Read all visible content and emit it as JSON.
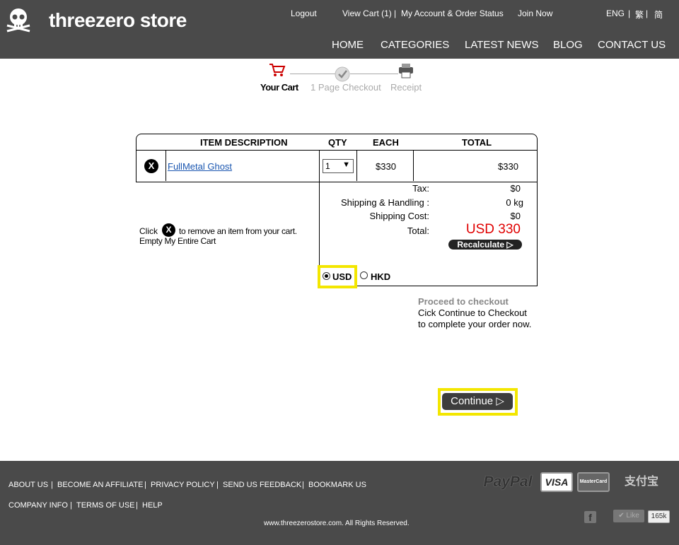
{
  "header": {
    "brand": "threezero store",
    "top_links": [
      "Logout",
      "View Cart (1)",
      "|",
      "My Account & Order Status",
      "Join Now",
      "ENG",
      "|",
      "繁",
      "|",
      "简"
    ],
    "nav": [
      "HOME",
      "CATEGORIES",
      "LATEST NEWS",
      "BLOG",
      "CONTACT US"
    ]
  },
  "progress": {
    "steps": [
      "Your Cart",
      "1 Page Checkout",
      "Receipt"
    ],
    "active_index": 0
  },
  "cart": {
    "headers": [
      "ITEM DESCRIPTION",
      "QTY",
      "EACH",
      "TOTAL"
    ],
    "remove_glyph": "X",
    "items": [
      {
        "name": "FullMetal Ghost",
        "qty": "1",
        "each": "$330",
        "total": "$330"
      }
    ],
    "help_text": {
      "before": "Click",
      "after": "to remove an item from your cart.",
      "empty": "Empty My Entire Cart"
    },
    "summary": {
      "tax_label": "Tax:",
      "tax_value": "$0",
      "shipping_label": "Shipping & Handling :",
      "shipping_value": "0 kg",
      "shipcost_label": "Shipping Cost:",
      "shipcost_value": "$0",
      "total_label": "Total:",
      "total_value": "USD 330",
      "recalc_label": "Recalculate",
      "total_color": "#e00000"
    },
    "currency": {
      "options": [
        "USD",
        "HKD"
      ],
      "selected": "USD"
    }
  },
  "checkout": {
    "heading": "Proceed to checkout",
    "line1": "Cick Continue to Checkout",
    "line2": "to complete your order now.",
    "continue_label": "Continue"
  },
  "footer": {
    "row1": [
      "ABOUT US",
      "BECOME AN AFFILIATE",
      "PRIVACY POLICY",
      "SEND US FEEDBACK",
      "BOOKMARK US"
    ],
    "row2": [
      "COMPANY INFO",
      "TERMS OF USE",
      "HELP"
    ],
    "copyright": "www.threezerostore.com. All Rights Reserved.",
    "payments": [
      "PayPal",
      "VISA",
      "MasterCard",
      "支付宝"
    ],
    "like_label": "Like",
    "like_count": "165k"
  },
  "colors": {
    "header_bg": "#4a4a4a",
    "highlight": "#f3e600",
    "link": "#1a56b0"
  }
}
